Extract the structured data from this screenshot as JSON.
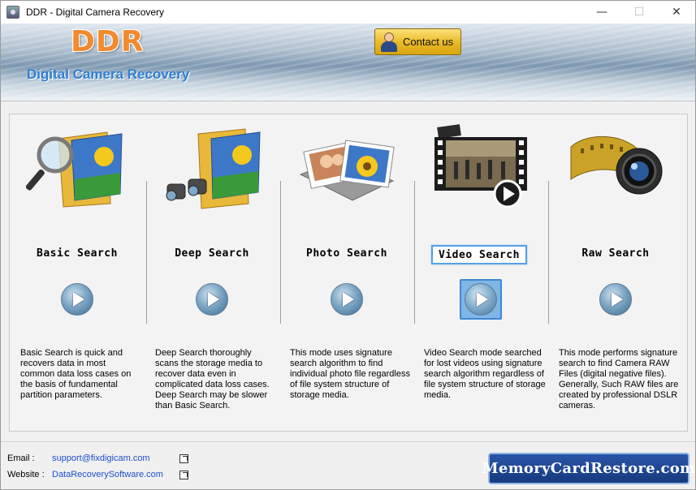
{
  "window": {
    "title": "DDR - Digital Camera Recovery",
    "controls": {
      "minimize": "—",
      "maximize": "☐",
      "close": "✕"
    }
  },
  "header": {
    "brand": "DDR",
    "subtitle": "Digital Camera Recovery",
    "contact_label": "Contact us"
  },
  "options": [
    {
      "label": "Basic Search",
      "selected": false,
      "icon": "folder-magnifier-icon",
      "description": "Basic Search is quick and recovers data in most common data loss cases on the basis of fundamental partition parameters."
    },
    {
      "label": "Deep Search",
      "selected": false,
      "icon": "folder-binoculars-icon",
      "description": "Deep Search thoroughly scans the storage media to recover data even in complicated data loss cases. Deep Search may be slower than Basic Search."
    },
    {
      "label": "Photo Search",
      "selected": false,
      "icon": "photos-icon",
      "description": "This mode uses signature search algorithm to find individual photo file regardless of file system structure of storage media."
    },
    {
      "label": "Video Search",
      "selected": true,
      "icon": "film-video-icon",
      "description": "Video Search mode searched for lost videos using signature search algorithm regardless of file system structure of storage media."
    },
    {
      "label": "Raw Search",
      "selected": false,
      "icon": "film-lens-icon",
      "description": "This mode performs signature search to find Camera RAW Files (digital negative files). Generally, Such RAW files are created by professional DSLR cameras."
    }
  ],
  "footer": {
    "email_label": "Email :",
    "email": "support@fixdigicam.com",
    "website_label": "Website :",
    "website": "DataRecoverySoftware.com",
    "logo_text": "MemoryCardRestore.com"
  },
  "colors": {
    "brand_orange": "#f28a2e",
    "subtitle_blue": "#2f7fd0",
    "link_blue": "#1f4fcf",
    "selection_blue": "#56a0e8"
  }
}
